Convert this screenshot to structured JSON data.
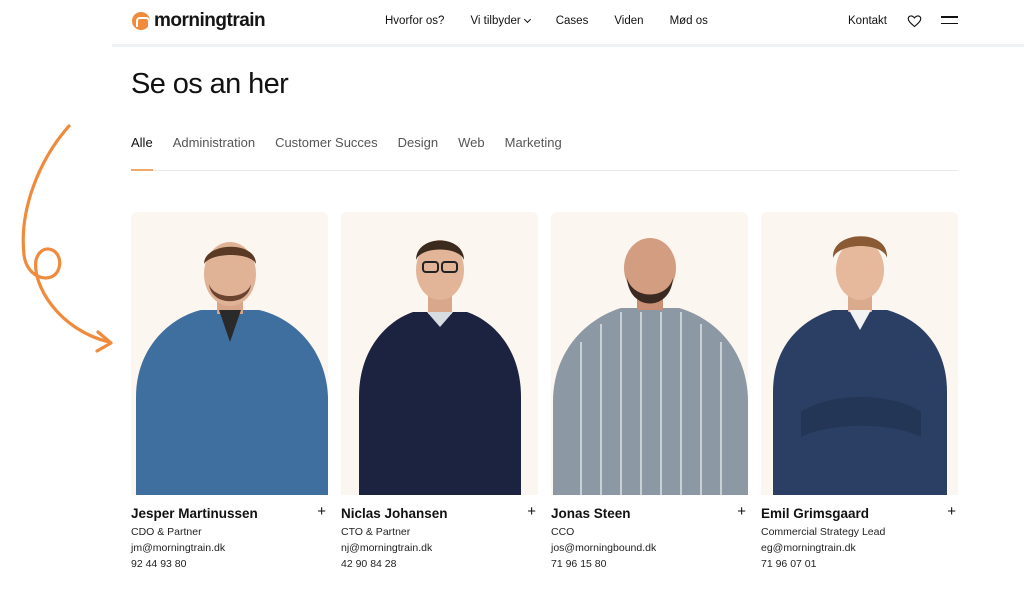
{
  "header": {
    "logo_text": "morningtrain",
    "nav": [
      {
        "label": "Hvorfor os?"
      },
      {
        "label": "Vi tilbyder"
      },
      {
        "label": "Cases"
      },
      {
        "label": "Viden"
      },
      {
        "label": "Mød os"
      }
    ],
    "contact_label": "Kontakt",
    "icons": [
      "heart-icon",
      "menu-icon"
    ]
  },
  "main": {
    "title": "Se os an her",
    "tabs": [
      {
        "label": "Alle"
      },
      {
        "label": "Administration"
      },
      {
        "label": "Customer Succes"
      },
      {
        "label": "Design"
      },
      {
        "label": "Web"
      },
      {
        "label": "Marketing"
      }
    ],
    "active_tab": "Alle"
  },
  "team": [
    {
      "name": "Jesper Martinussen",
      "role": "CDO & Partner",
      "email": "jm@morningtrain.dk",
      "phone": "92 44 93 80",
      "shirt_color": "#3f6f9f"
    },
    {
      "name": "Niclas Johansen",
      "role": "CTO & Partner",
      "email": "nj@morningtrain.dk",
      "phone": "42 90 84 28",
      "shirt_color": "#1c2340"
    },
    {
      "name": "Jonas Steen",
      "role": "CCO",
      "email": "jos@morningbound.dk",
      "phone": "71 96 15 80",
      "shirt_color": "#8c98a3"
    },
    {
      "name": "Emil Grimsgaard",
      "role": "Commercial Strategy Lead",
      "email": "eg@morningtrain.dk",
      "phone": "71 96 07 01",
      "shirt_color": "#2a3f63"
    }
  ],
  "colors": {
    "accent": "#f08a3c",
    "card_bg": "#fcf6f0",
    "text": "#111111"
  }
}
